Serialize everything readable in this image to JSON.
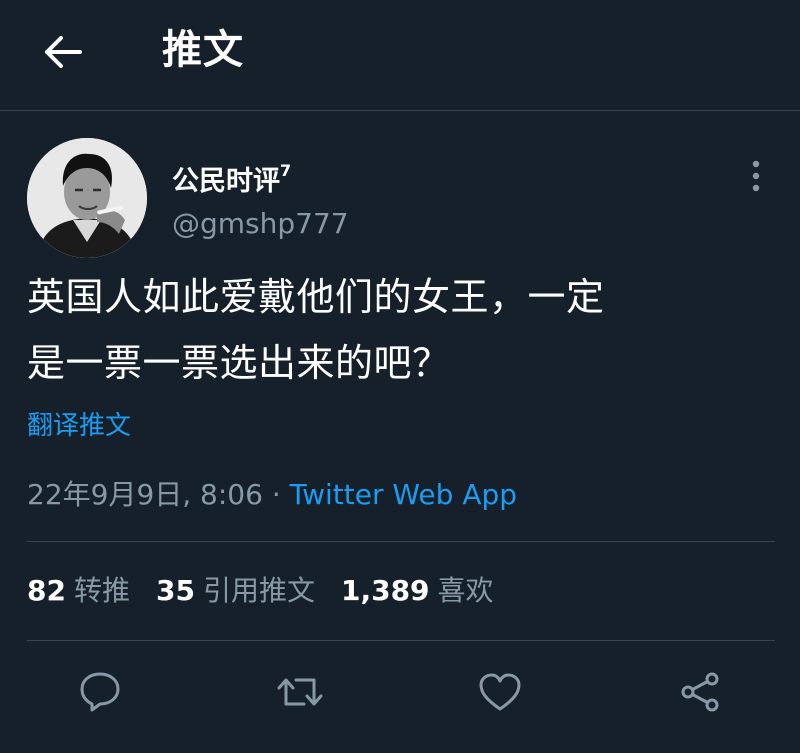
{
  "header": {
    "back_icon": "arrow-left-icon",
    "title": "推文"
  },
  "author": {
    "display_name": "公民时评",
    "name_suffix": "7",
    "handle": "@gmshp777"
  },
  "tweet": {
    "line1": "英国人如此爱戴他们的女王，一定",
    "line2": "是一票一票选出来的吧？",
    "translate_label": "翻译推文",
    "timestamp": "22年9月9日, 8:06",
    "separator": " · ",
    "source": "Twitter Web App"
  },
  "stats": {
    "retweets_count": "82",
    "retweets_label": "转推",
    "quotes_count": "35",
    "quotes_label": "引用推文",
    "likes_count": "1,389",
    "likes_label": "喜欢"
  },
  "actions": {
    "reply_icon": "reply-icon",
    "retweet_icon": "retweet-icon",
    "like_icon": "heart-icon",
    "share_icon": "share-icon"
  },
  "colors": {
    "background": "#15202b",
    "text": "#ffffff",
    "secondary": "#8899a6",
    "accent": "#1d9bf0",
    "divider": "#38444d"
  }
}
